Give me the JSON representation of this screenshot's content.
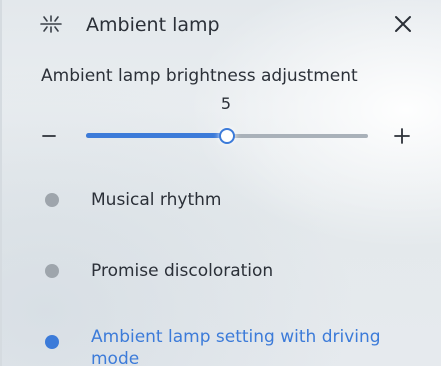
{
  "header": {
    "title": "Ambient lamp",
    "icon": "ambient-lamp-icon",
    "close_icon": "close-icon"
  },
  "brightness": {
    "label": "Ambient lamp brightness adjustment",
    "value": "5",
    "level_fraction": 0.5,
    "decrease_icon": "minus-icon",
    "increase_icon": "plus-icon"
  },
  "options": [
    {
      "label": "Musical rhythm",
      "selected": false
    },
    {
      "label": "Promise discoloration",
      "selected": false
    },
    {
      "label": "Ambient lamp setting with driving mode",
      "selected": true
    }
  ],
  "colors": {
    "accent": "#3c7bd9",
    "inactive_dot": "#9ea5ac",
    "track": "#a9b1b9",
    "text": "#2b3038"
  }
}
